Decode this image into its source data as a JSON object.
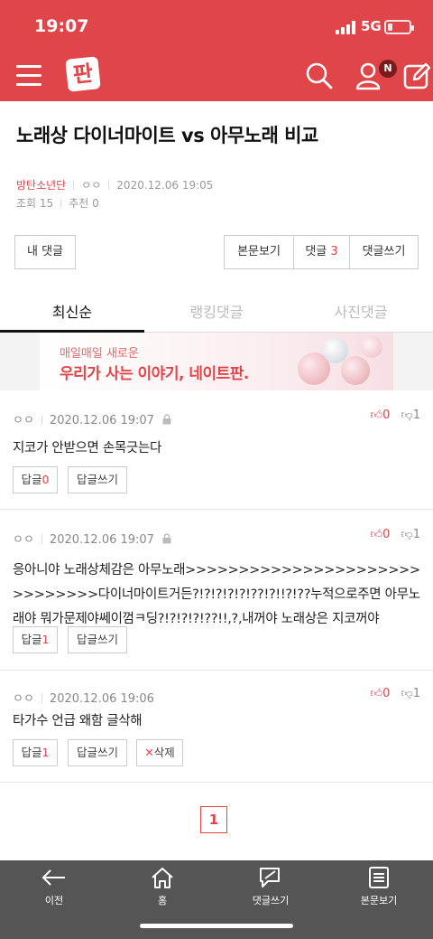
{
  "status": {
    "time": "19:07",
    "network": "5G"
  },
  "header": {
    "logo": "판",
    "notification_badge": "N"
  },
  "post": {
    "title": "노래상 다이너마이트 vs 아무노래 비교",
    "author": "방탄소년단",
    "nickname": "ㅇㅇ",
    "date": "2020.12.06 19:05",
    "views_label": "조회",
    "views": "15",
    "likes_label": "추천",
    "likes": "0"
  },
  "actions": {
    "my_comments": "내 댓글",
    "view_body": "본문보기",
    "comments_label": "댓글",
    "comments_count": "3",
    "write_comment": "댓글쓰기"
  },
  "tabs": [
    "최신순",
    "랭킹댓글",
    "사진댓글"
  ],
  "banner": {
    "sub": "매일매일 새로운",
    "main": "우리가 사는 이야기, 네이트판."
  },
  "comments": [
    {
      "author": "ㅇㅇ",
      "date": "2020.12.06 19:07",
      "up": "0",
      "down": "1",
      "text": "지코가 안받으면 손목긋는다",
      "reply_label": "답글",
      "reply_count": "0",
      "write_reply": "답글쓰기"
    },
    {
      "author": "ㅇㅇ",
      "date": "2020.12.06 19:07",
      "up": "0",
      "down": "1",
      "text": "응아니야 노래상체감은 아무노래>>>>>>>>>>>>>>>>>>>>>>>>>>>>>>다이너마이트거든?!?!?!?!?!??!?!!?!??누적으로주면 아무노래야 뭐가문제야쎄이껌ㅋ딩?!?!?!?!??!!,?,내꺼야 노래상은 지코꺼야",
      "reply_label": "답글",
      "reply_count": "1",
      "write_reply": "답글쓰기"
    },
    {
      "author": "ㅇㅇ",
      "date": "2020.12.06 19:06",
      "up": "0",
      "down": "1",
      "text": "타가수 언급 왜함 글삭해",
      "reply_label": "답글",
      "reply_count": "1",
      "write_reply": "답글쓰기",
      "delete_label": "삭제"
    }
  ],
  "pagination": {
    "current": "1"
  },
  "bottom_nav": [
    "이전",
    "홈",
    "댓글쓰기",
    "본문보기"
  ],
  "colors": {
    "brand": "#e0454a",
    "bottom_bar": "#555555"
  }
}
